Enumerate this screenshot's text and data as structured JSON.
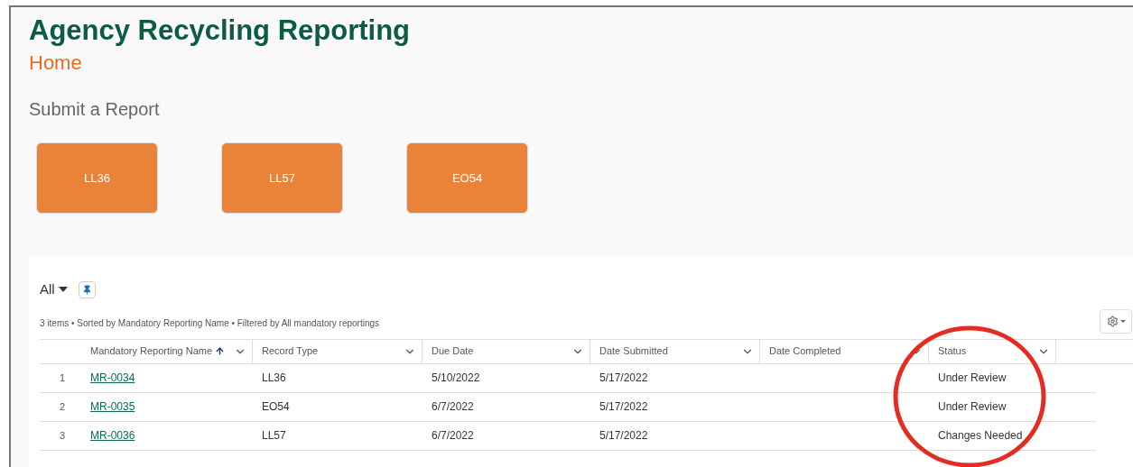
{
  "app_title": "Agency Recycling Reporting",
  "page": "Home",
  "section_title": "Submit a Report",
  "report_buttons": [
    "LL36",
    "LL57",
    "EO54"
  ],
  "list_view": {
    "name": "All",
    "summary": "3 items • Sorted by Mandatory Reporting Name • Filtered by All mandatory reportings"
  },
  "table": {
    "columns": [
      {
        "label": "Mandatory Reporting Name",
        "sorted": true
      },
      {
        "label": "Record Type",
        "sorted": false
      },
      {
        "label": "Due Date",
        "sorted": false
      },
      {
        "label": "Date Submitted",
        "sorted": false
      },
      {
        "label": "Date Completed",
        "sorted": false
      },
      {
        "label": "Status",
        "sorted": false
      }
    ],
    "rows": [
      {
        "number": "1",
        "cells": [
          "MR-0034",
          "LL36",
          "5/10/2022",
          "5/17/2022",
          "",
          "Under Review"
        ]
      },
      {
        "number": "2",
        "cells": [
          "MR-0035",
          "EO54",
          "6/7/2022",
          "5/17/2022",
          "",
          "Under Review"
        ]
      },
      {
        "number": "3",
        "cells": [
          "MR-0036",
          "LL57",
          "6/7/2022",
          "5/17/2022",
          "",
          "Changes Needed"
        ]
      }
    ]
  }
}
